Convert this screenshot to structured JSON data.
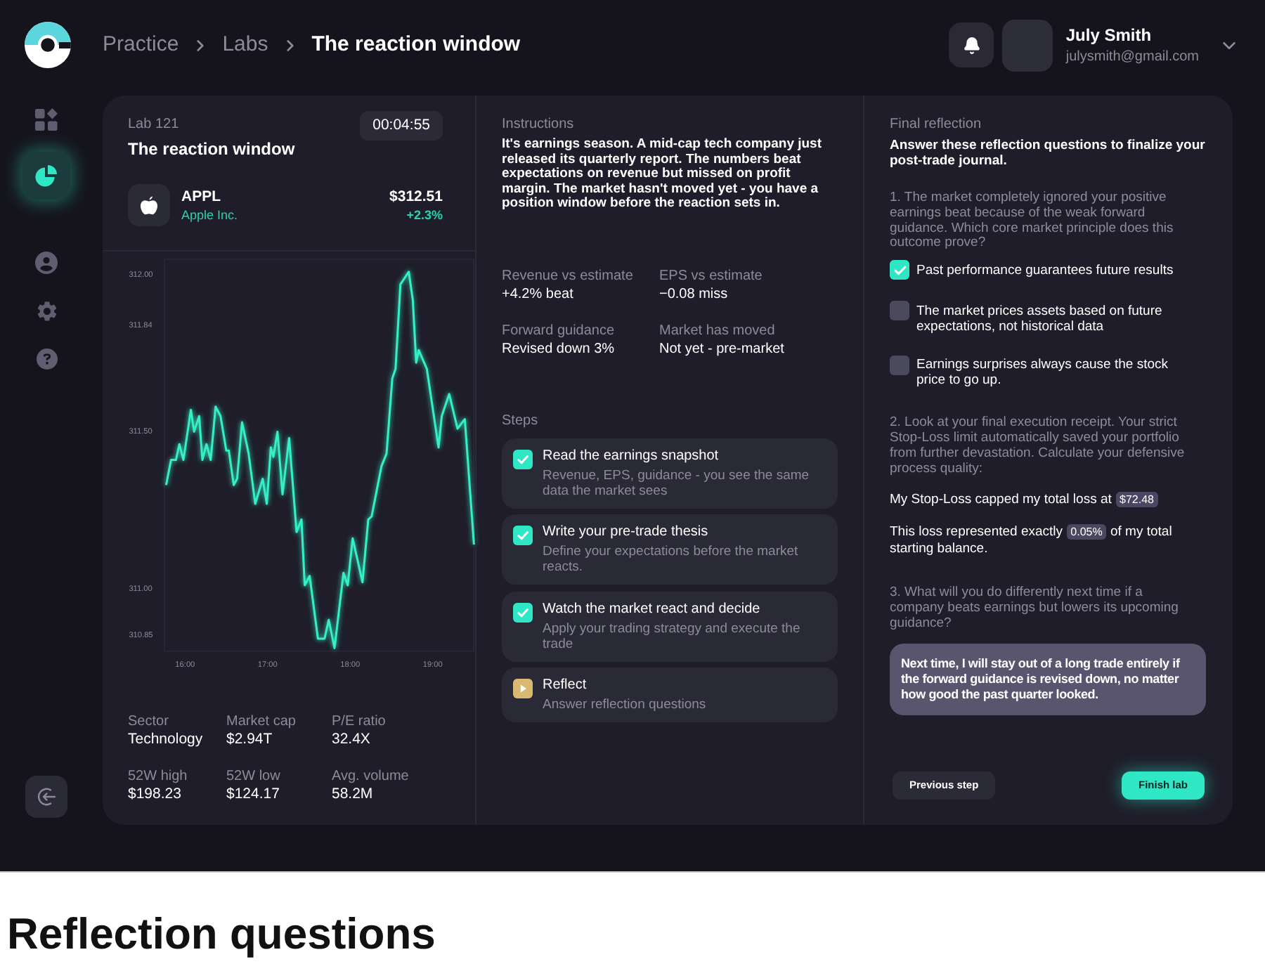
{
  "breadcrumb": [
    {
      "label": "Practice",
      "current": false
    },
    {
      "label": "Labs",
      "current": false
    },
    {
      "label": "The reaction window",
      "current": true
    }
  ],
  "user": {
    "name": "July Smith",
    "email": "julysmith@gmail.com"
  },
  "sidebar": {
    "items": [
      {
        "selected": false
      },
      {
        "selected": true
      },
      {
        "selected": false
      },
      {
        "selected": false
      },
      {
        "selected": false
      }
    ]
  },
  "lab": {
    "number": "Lab 121",
    "title": "The reaction window",
    "timer": "00:04:55"
  },
  "stock": {
    "ticker": "APPL",
    "company": "Apple Inc.",
    "price": "$312.51",
    "change": "+2.3%",
    "chart_data": {
      "type": "line",
      "x": [
        15.77,
        15.83,
        15.89,
        15.93,
        15.98,
        16.07,
        16.11,
        16.17,
        16.21,
        16.26,
        16.31,
        16.37,
        16.43,
        16.5,
        16.53,
        16.59,
        16.63,
        16.69,
        16.77,
        16.85,
        16.94,
        16.99,
        17.04,
        17.07,
        17.12,
        17.18,
        17.26,
        17.35,
        17.41,
        17.45,
        17.51,
        17.61,
        17.69,
        17.74,
        17.81,
        17.92,
        17.97,
        18.03,
        18.15,
        18.22,
        18.26,
        18.38,
        18.44,
        18.51,
        18.55,
        18.61,
        18.71,
        18.76,
        18.8,
        18.83,
        18.93,
        19.07,
        19.11,
        19.2,
        19.3,
        19.39,
        19.5
      ],
      "values": [
        311.33,
        311.41,
        311.41,
        311.46,
        311.41,
        311.57,
        311.5,
        311.55,
        311.41,
        311.46,
        311.41,
        311.58,
        311.55,
        311.44,
        311.44,
        311.33,
        311.35,
        311.53,
        311.43,
        311.27,
        311.35,
        311.27,
        311.45,
        311.42,
        311.5,
        311.3,
        311.48,
        311.18,
        311.22,
        311.01,
        311.04,
        310.84,
        310.84,
        310.9,
        310.81,
        311.05,
        311.01,
        311.16,
        311.02,
        311.22,
        311.23,
        311.39,
        311.43,
        311.67,
        311.7,
        311.97,
        312.01,
        311.92,
        311.72,
        311.76,
        311.7,
        311.45,
        311.55,
        311.62,
        311.51,
        311.54,
        311.14
      ],
      "xlim": [
        15.75,
        19.5
      ],
      "ylim": [
        310.8,
        312.05
      ],
      "xticks": [
        {
          "value": 16,
          "label": "16:00"
        },
        {
          "value": 17,
          "label": "17:00"
        },
        {
          "value": 18,
          "label": "18:00"
        },
        {
          "value": 19,
          "label": "19:00"
        }
      ],
      "yticks": [
        {
          "value": 312,
          "label": "312.00"
        },
        {
          "value": 311.84,
          "label": "311.84"
        },
        {
          "value": 311.5,
          "label": "311.50"
        },
        {
          "value": 311,
          "label": "311.00"
        },
        {
          "value": 310.85,
          "label": "310.85"
        }
      ]
    }
  },
  "stats": [
    {
      "label": "Sector",
      "value": "Technology"
    },
    {
      "label": "Market cap",
      "value": "$2.94T"
    },
    {
      "label": "P/E ratio",
      "value": "32.4X"
    },
    {
      "label": "52W high",
      "value": "$198.23"
    },
    {
      "label": "52W low",
      "value": "$124.17"
    },
    {
      "label": "Avg. volume",
      "value": "58.2M"
    }
  ],
  "instructions": {
    "heading": "Instructions",
    "text": "It's earnings season. A mid-cap tech company just released its quarterly report. The numbers beat expectations on revenue but missed on profit margin. The market hasn't moved yet - you have a position window before the reaction sets in."
  },
  "metrics": [
    {
      "label": "Revenue vs estimate",
      "value": "+4.2% beat"
    },
    {
      "label": "EPS vs estimate",
      "value": "−0.08 miss"
    },
    {
      "label": "Forward guidance",
      "value": "Revised down 3%"
    },
    {
      "label": "Market has moved",
      "value": "Not yet - pre-market"
    }
  ],
  "steps": {
    "heading": "Steps",
    "items": [
      {
        "title": "Read the earnings snapshot",
        "description": "Revenue, EPS, guidance - you see the same data the market sees",
        "completed": true
      },
      {
        "title": "Write your pre-trade thesis",
        "description": "Define your expectations before the market reacts.",
        "completed": true
      },
      {
        "title": "Watch the market react and decide",
        "description": "Apply your trading strategy and execute the trade",
        "completed": true
      },
      {
        "title": "Reflect",
        "description": "Answer reflection questions",
        "completed": false
      }
    ]
  },
  "reflection": {
    "heading": "Final reflection",
    "intro": "Answer these reflection questions to finalize your post-trade journal.",
    "questions": [
      {
        "kind": "choice",
        "prompt": "1. The market completely ignored your positive earnings beat because of the weak forward guidance. Which core market principle does this outcome prove?",
        "options": [
          {
            "label": "Past performance guarantees future results",
            "checked": true
          },
          {
            "label": "The market prices assets based on future expectations, not historical data",
            "checked": false
          },
          {
            "label": "Earnings surprises always cause the stock price to go up.",
            "checked": false
          }
        ]
      },
      {
        "kind": "fill",
        "prompt": "2. Look at your final execution receipt. Your strict Stop-Loss limit automatically saved your portfolio from further devastation. Calculate your defensive process quality:",
        "blanks": [
          {
            "before": "My Stop-Loss capped my total loss at",
            "value": "$72.48"
          },
          {
            "before": "This loss represented exactly",
            "value": "0.05%",
            "after": "of my total starting balance."
          }
        ]
      },
      {
        "kind": "text",
        "prompt": "3. What will you do differently next time if a company beats earnings but lowers its upcoming guidance?",
        "answer": "Next time, I will stay out of a long trade entirely if the forward guidance is revised down, no matter how good the past quarter looked."
      }
    ],
    "buttons": [
      {
        "label": "Previous step",
        "kind": "secondary"
      },
      {
        "label": "Finish lab",
        "kind": "primary"
      }
    ]
  },
  "page_heading": "Reflection questions"
}
